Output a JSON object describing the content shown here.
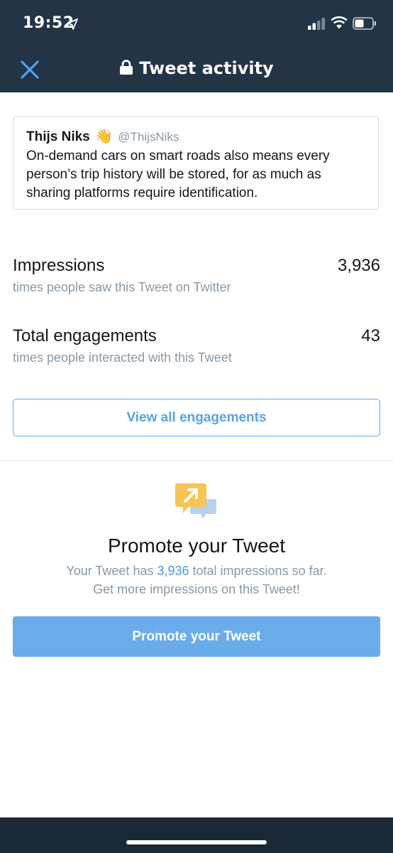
{
  "status_bar": {
    "time": "19:52",
    "icons": [
      "location-arrow-icon",
      "signal-icon",
      "wifi-icon",
      "battery-icon"
    ]
  },
  "nav": {
    "title": "Tweet activity",
    "close_icon": "close-icon",
    "lock_icon": "lock-icon"
  },
  "tweet": {
    "name": "Thijs Niks",
    "emoji": "👋",
    "handle": "@ThijsNiks",
    "text": "On-demand cars on smart roads also means every person’s trip history will be stored, for as much as sharing platforms require identification."
  },
  "metrics": [
    {
      "label": "Impressions",
      "value": "3,936",
      "description": "times people saw this Tweet on Twitter"
    },
    {
      "label": "Total engagements",
      "value": "43",
      "description": "times people interacted with this Tweet"
    }
  ],
  "view_all_label": "View all engagements",
  "promote": {
    "icon": "promote-chat-arrow-icon",
    "title": "Promote your Tweet",
    "text_before": "Your Tweet has ",
    "impressions": "3,936",
    "text_after": " total impressions so far.",
    "text_line2": "Get more impressions on this Tweet!",
    "button_label": "Promote your Tweet"
  },
  "colors": {
    "header_bg": "#243447",
    "accent": "#1da1f2",
    "button_blue": "#6aabea",
    "secondary_text": "#8899a6"
  }
}
